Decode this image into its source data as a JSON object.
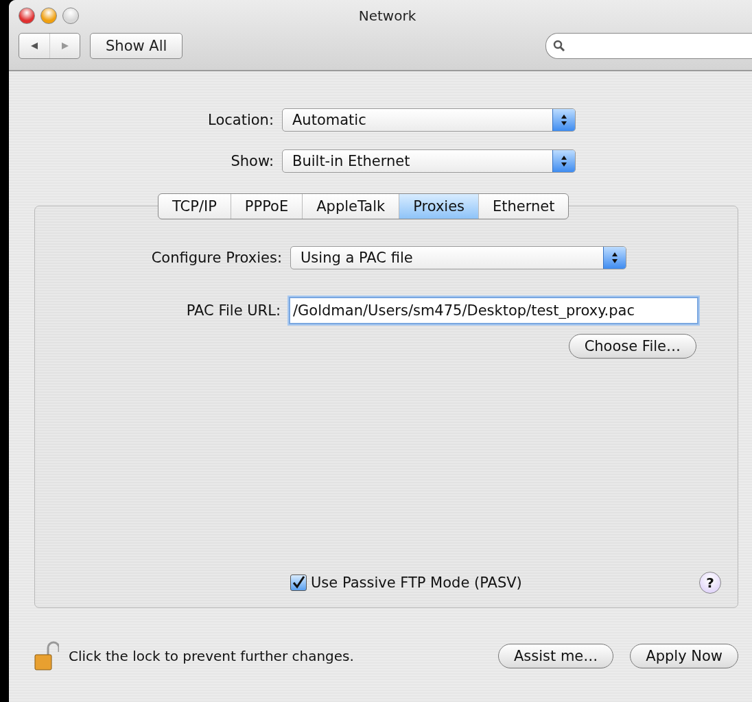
{
  "window": {
    "title": "Network"
  },
  "toolbar": {
    "show_all": "Show All"
  },
  "location": {
    "label": "Location:",
    "value": "Automatic"
  },
  "show": {
    "label": "Show:",
    "value": "Built-in Ethernet"
  },
  "tabs": [
    {
      "label": "TCP/IP",
      "selected": false
    },
    {
      "label": "PPPoE",
      "selected": false
    },
    {
      "label": "AppleTalk",
      "selected": false
    },
    {
      "label": "Proxies",
      "selected": true
    },
    {
      "label": "Ethernet",
      "selected": false
    }
  ],
  "configure_proxies": {
    "label": "Configure Proxies:",
    "value": "Using a PAC file"
  },
  "pac_file_url": {
    "label": "PAC File URL:",
    "value": "/Goldman/Users/sm475/Desktop/test_proxy.pac"
  },
  "choose_file": "Choose File…",
  "passive_ftp": {
    "label": "Use Passive FTP Mode (PASV)",
    "checked": true
  },
  "help": "?",
  "lock": {
    "text": "Click the lock to prevent further changes.",
    "locked": false
  },
  "buttons": [
    "Assist me…",
    "Apply Now"
  ]
}
